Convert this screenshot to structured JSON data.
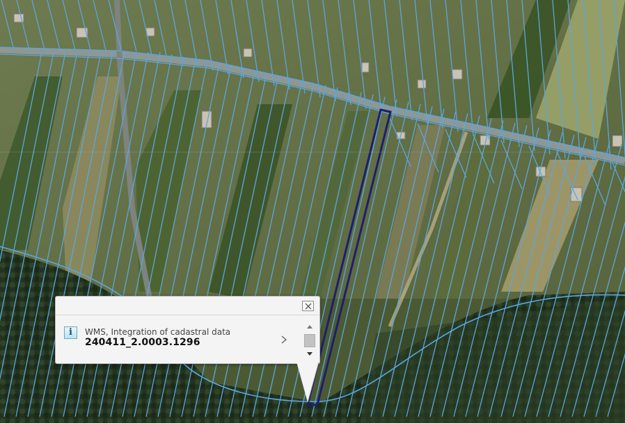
{
  "map": {
    "parcel_line_color": "#5aa7e0",
    "selected_parcel_color": "#1d1f6e",
    "road_color": "#8f9794"
  },
  "popup": {
    "source_label": "WMS, Integration of cadastral data",
    "parcel_id": "240411_2.0003.1296",
    "info_icon_glyph": "i",
    "icons": [
      "info-icon",
      "close-icon",
      "chevron-right-icon",
      "scroll-up-icon",
      "scroll-down-icon"
    ]
  }
}
